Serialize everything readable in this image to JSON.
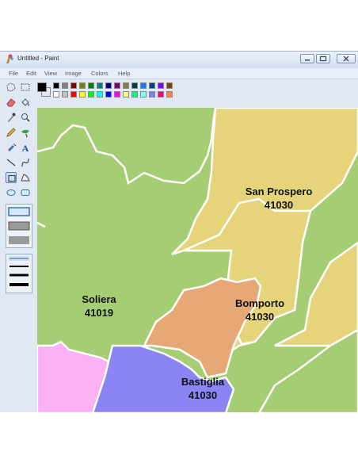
{
  "window": {
    "title": "Untitled - Paint"
  },
  "menu": [
    "File",
    "Edit",
    "View",
    "Image",
    "Colors",
    "Help"
  ],
  "palette": {
    "foreground": "#000000",
    "background": "#ffffff",
    "row1": [
      "#000000",
      "#808080",
      "#800000",
      "#808000",
      "#008000",
      "#008080",
      "#000080",
      "#800080",
      "#808040",
      "#004040",
      "#0080ff",
      "#004080",
      "#8000ff",
      "#804000"
    ],
    "row2": [
      "#ffffff",
      "#c0c0c0",
      "#ff0000",
      "#ffff00",
      "#00ff00",
      "#00ffff",
      "#0000ff",
      "#ff00ff",
      "#ffff80",
      "#00ff80",
      "#80ffff",
      "#8080ff",
      "#ff0080",
      "#ff8040"
    ]
  },
  "map": {
    "regions": [
      {
        "name": "San Prospero",
        "code": "41030",
        "color": "#e5d47a"
      },
      {
        "name": "Soliera",
        "code": "41019",
        "color": "#a5cd73"
      },
      {
        "name": "Bomporto",
        "code": "41030",
        "color": "#e5d47a"
      },
      {
        "name": "Bastiglia",
        "code": "41030",
        "color": "#e6a876"
      }
    ],
    "other_colors": {
      "pink": "#f9b0f4",
      "blue": "#8a84f4",
      "green": "#a5cd73"
    }
  }
}
